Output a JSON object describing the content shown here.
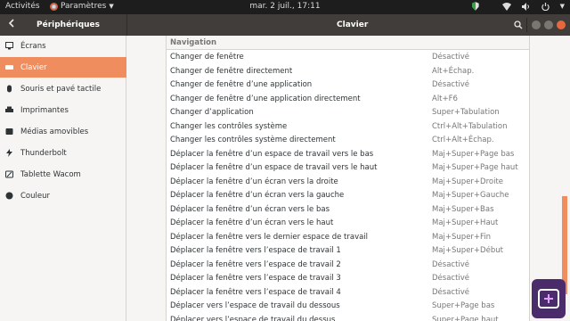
{
  "topbar": {
    "activities": "Activités",
    "app_name": "Paramètres",
    "clock": "mar.  2 juil., 17:11"
  },
  "header": {
    "left_title": "Périphériques",
    "center_title": "Clavier"
  },
  "sidebar": {
    "items": [
      {
        "label": "Écrans",
        "icon": "display-icon"
      },
      {
        "label": "Clavier",
        "icon": "keyboard-icon",
        "active": true
      },
      {
        "label": "Souris et pavé tactile",
        "icon": "mouse-icon"
      },
      {
        "label": "Imprimantes",
        "icon": "printer-icon"
      },
      {
        "label": "Médias amovibles",
        "icon": "removable-media-icon"
      },
      {
        "label": "Thunderbolt",
        "icon": "thunderbolt-icon"
      },
      {
        "label": "Tablette Wacom",
        "icon": "tablet-icon"
      },
      {
        "label": "Couleur",
        "icon": "color-icon"
      }
    ]
  },
  "main": {
    "section_title": "Navigation",
    "rows": [
      {
        "name": "Changer de fenêtre",
        "accel": "Désactivé"
      },
      {
        "name": "Changer de fenêtre directement",
        "accel": "Alt+Échap."
      },
      {
        "name": "Changer de fenêtre d’une application",
        "accel": "Désactivé"
      },
      {
        "name": "Changer de fenêtre d’une application directement",
        "accel": "Alt+F6"
      },
      {
        "name": "Changer d’application",
        "accel": "Super+Tabulation"
      },
      {
        "name": "Changer les contrôles système",
        "accel": "Ctrl+Alt+Tabulation"
      },
      {
        "name": "Changer les contrôles système directement",
        "accel": "Ctrl+Alt+Échap."
      },
      {
        "name": "Déplacer la fenêtre d’un espace de travail vers le bas",
        "accel": "Maj+Super+Page bas"
      },
      {
        "name": "Déplacer la fenêtre d’un espace de travail vers le haut",
        "accel": "Maj+Super+Page haut"
      },
      {
        "name": "Déplacer la fenêtre d’un écran vers la droite",
        "accel": "Maj+Super+Droite"
      },
      {
        "name": "Déplacer la fenêtre d’un écran vers la gauche",
        "accel": "Maj+Super+Gauche"
      },
      {
        "name": "Déplacer la fenêtre d’un écran vers le bas",
        "accel": "Maj+Super+Bas"
      },
      {
        "name": "Déplacer la fenêtre d’un écran vers le haut",
        "accel": "Maj+Super+Haut"
      },
      {
        "name": "Déplacer la fenêtre vers le dernier espace de travail",
        "accel": "Maj+Super+Fin"
      },
      {
        "name": "Déplacer la fenêtre vers l’espace de travail 1",
        "accel": "Maj+Super+Début"
      },
      {
        "name": "Déplacer la fenêtre vers l’espace de travail 2",
        "accel": "Désactivé"
      },
      {
        "name": "Déplacer la fenêtre vers l’espace de travail 3",
        "accel": "Désactivé"
      },
      {
        "name": "Déplacer la fenêtre vers l’espace de travail 4",
        "accel": "Désactivé"
      },
      {
        "name": "Déplacer vers l’espace de travail du dessous",
        "accel": "Super+Page bas"
      },
      {
        "name": "Déplacer vers l’espace de travail du dessus",
        "accel": "Super+Page haut"
      }
    ]
  },
  "colors": {
    "accent": "#f08d5e",
    "header_bg": "#403d3a",
    "topbar_bg": "#1d1d1d"
  }
}
